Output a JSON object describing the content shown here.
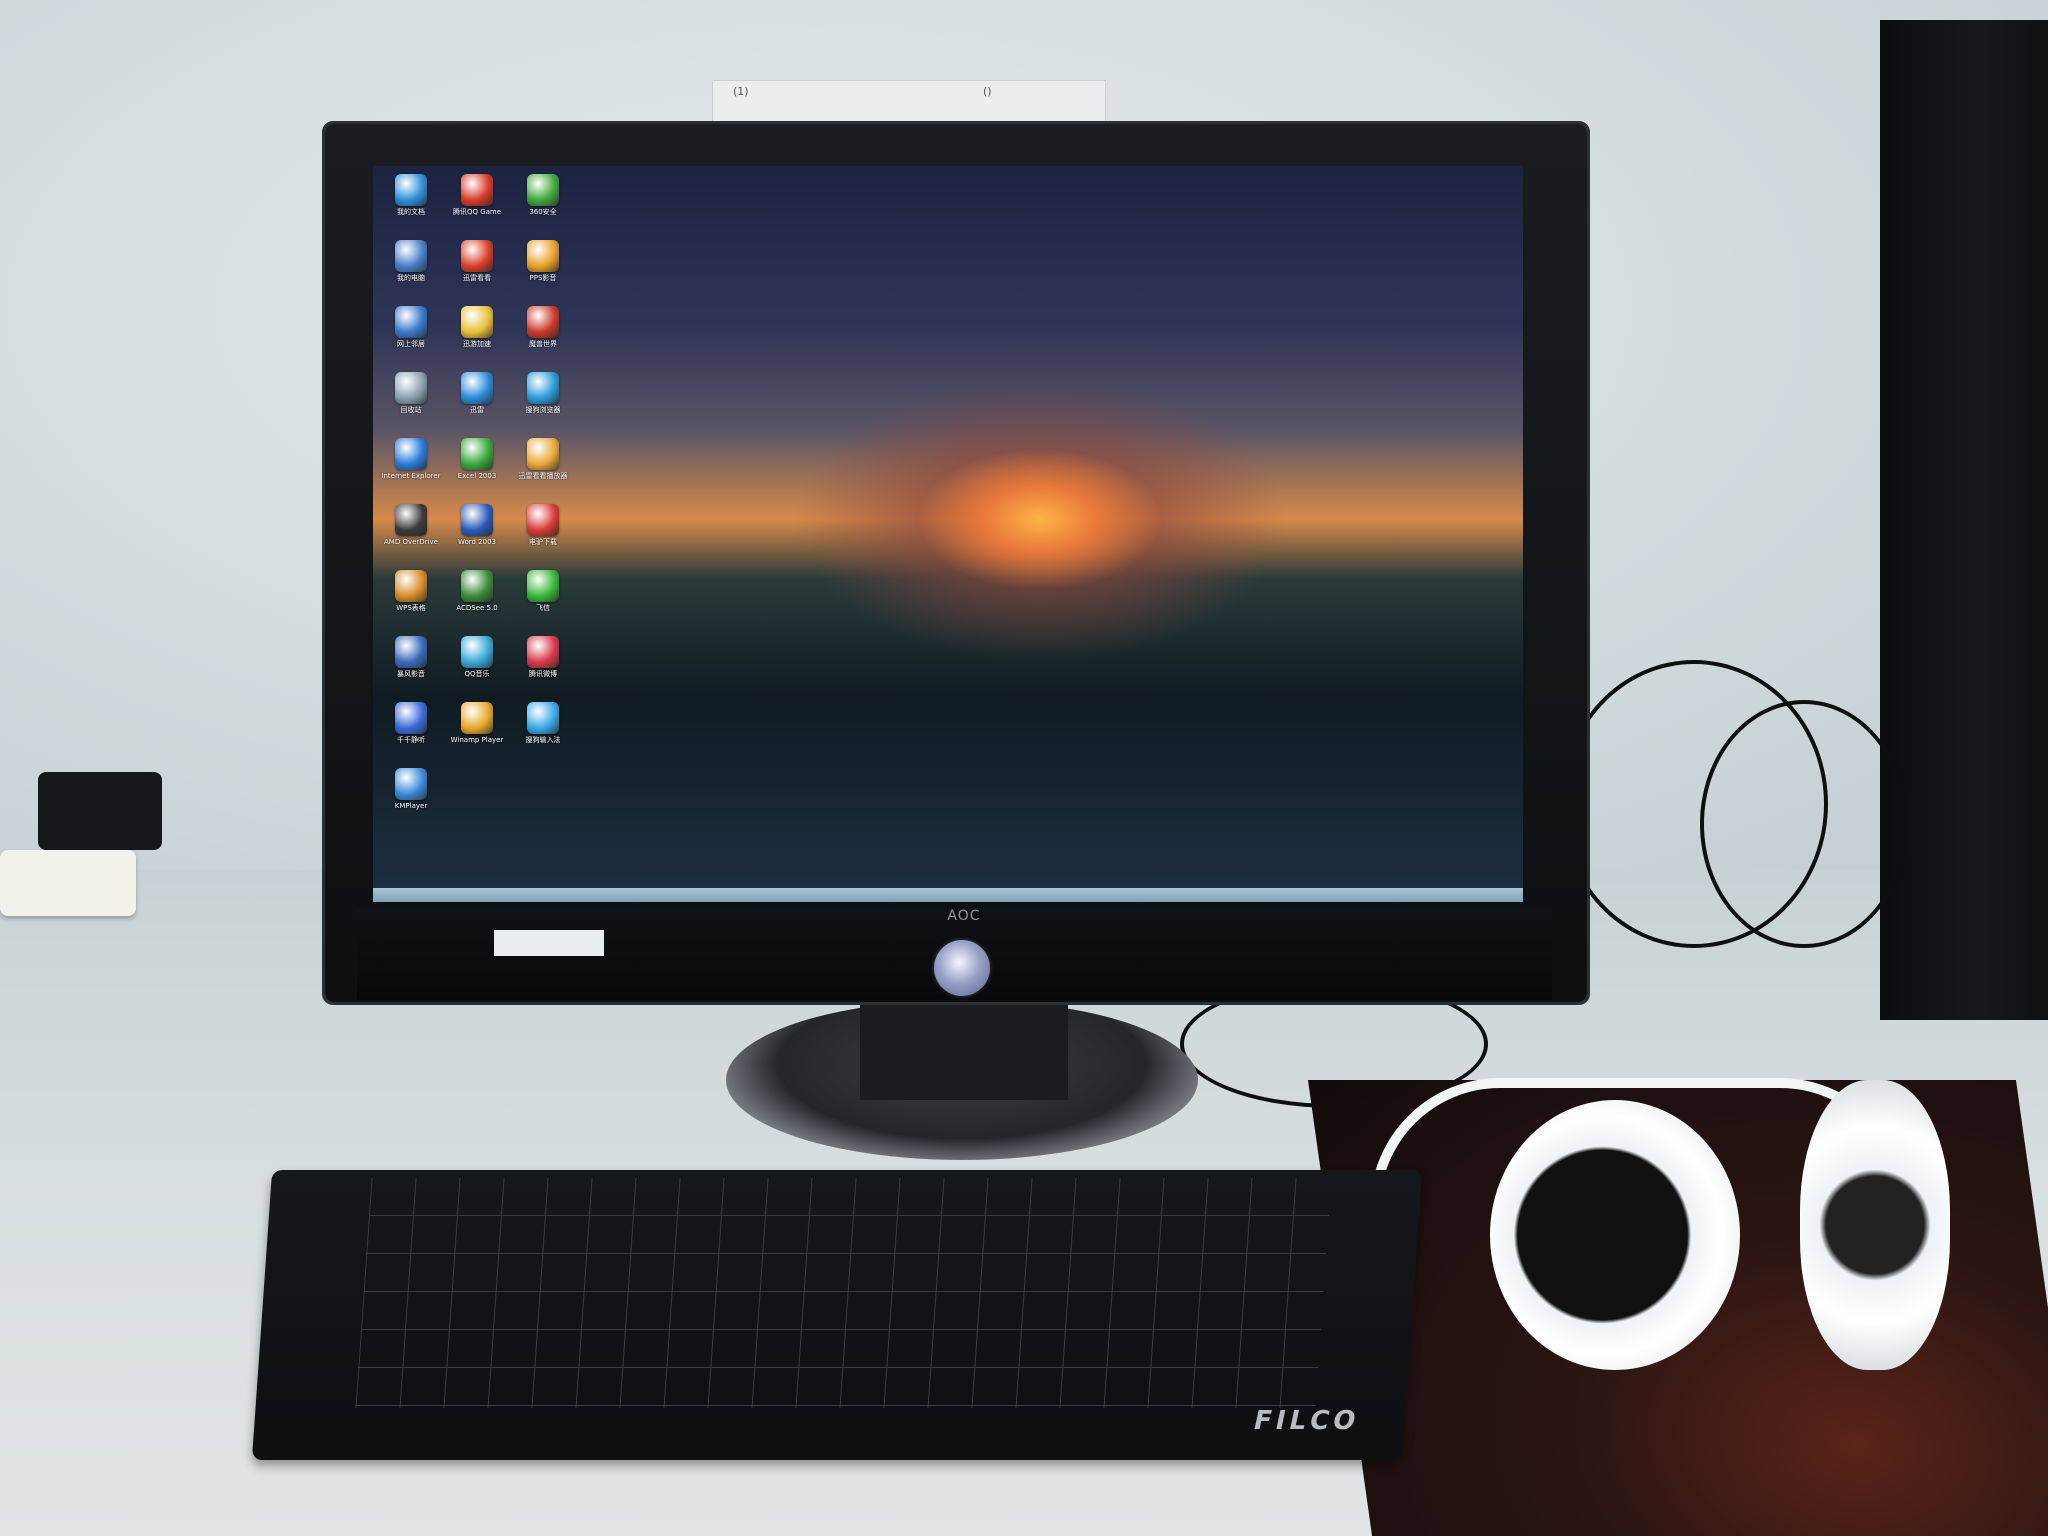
{
  "scene": {
    "monitor_logo": "AOC",
    "keyboard_brand": "FILCO",
    "note_texts": [
      "(1)",
      "()"
    ]
  },
  "desktop": {
    "icons": [
      {
        "label": "我的文档",
        "color": "#2f8fd8",
        "icon": "documents-icon"
      },
      {
        "label": "腾讯QQ Game",
        "color": "#d83a2a",
        "icon": "qqgame-icon"
      },
      {
        "label": "360安全",
        "color": "#3fa83a",
        "icon": "shield-icon"
      },
      {
        "label": "我的电脑",
        "color": "#4a7fc8",
        "icon": "computer-icon"
      },
      {
        "label": "迅雷看看",
        "color": "#d8402a",
        "icon": "player-icon"
      },
      {
        "label": "PPS影音",
        "color": "#e8a02a",
        "icon": "video-icon"
      },
      {
        "label": "网上邻居",
        "color": "#3a78c8",
        "icon": "network-icon"
      },
      {
        "label": "迅游加速",
        "color": "#e8c03a",
        "icon": "game-icon"
      },
      {
        "label": "魔兽世界",
        "color": "#c83a2a",
        "icon": "warcraft-icon"
      },
      {
        "label": "回收站",
        "color": "#8aa0b0",
        "icon": "recycle-bin-icon"
      },
      {
        "label": "迅雷",
        "color": "#2a8ad8",
        "icon": "thunder-icon"
      },
      {
        "label": "搜狗浏览器",
        "color": "#2a9ad8",
        "icon": "browser-icon"
      },
      {
        "label": "Internet Explorer",
        "color": "#2a7ad8",
        "icon": "ie-icon"
      },
      {
        "label": "Excel 2003",
        "color": "#3aa83a",
        "icon": "excel-icon"
      },
      {
        "label": "迅雷看看播放器",
        "color": "#e8a83a",
        "icon": "movie-icon"
      },
      {
        "label": "AMD OverDrive",
        "color": "#3a3a3a",
        "icon": "amd-icon"
      },
      {
        "label": "Word 2003",
        "color": "#2a5ab8",
        "icon": "word-icon"
      },
      {
        "label": "电驴下载",
        "color": "#d83a3a",
        "icon": "download-icon"
      },
      {
        "label": "WPS表格",
        "color": "#d88a2a",
        "icon": "wps-icon"
      },
      {
        "label": "ACDSee 5.0",
        "color": "#3a8a3a",
        "icon": "acdsee-icon"
      },
      {
        "label": "飞信",
        "color": "#3ab83a",
        "icon": "fetion-icon"
      },
      {
        "label": "暴风影音",
        "color": "#3a6ab8",
        "icon": "storm-icon"
      },
      {
        "label": "QQ音乐",
        "color": "#3aa8d8",
        "icon": "music-icon"
      },
      {
        "label": "腾讯微博",
        "color": "#d83a4a",
        "icon": "weibo-icon"
      },
      {
        "label": "千千静听",
        "color": "#3a6ad8",
        "icon": "ttplayer-icon"
      },
      {
        "label": "Winamp Player",
        "color": "#e8a82a",
        "icon": "winamp-icon"
      },
      {
        "label": "搜狗输入法",
        "color": "#3aa8e8",
        "icon": "input-icon"
      },
      {
        "label": "KMPlayer",
        "color": "#3a8ad8",
        "icon": "kmplayer-icon"
      }
    ]
  }
}
